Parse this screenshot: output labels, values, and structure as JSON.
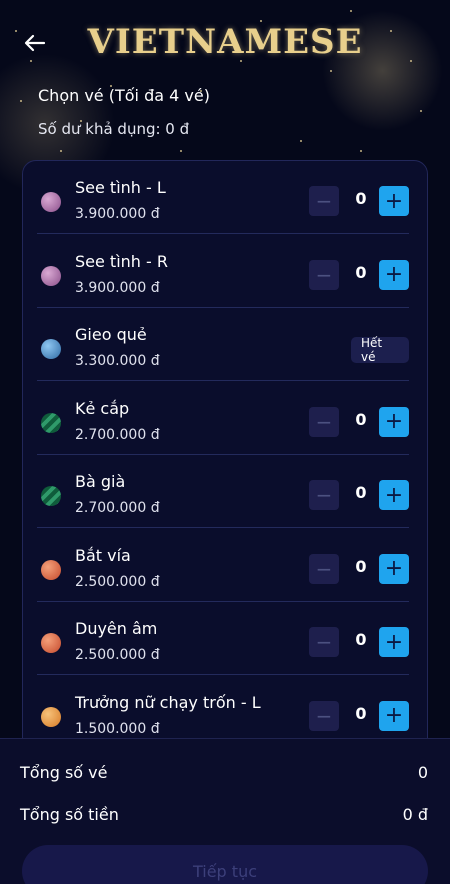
{
  "header": {
    "brand": "VIETNAMESE",
    "subtitle": "Chọn vé (Tối đa 4 vé)",
    "balance": "Số dư khả dụng: 0 đ"
  },
  "tickets": [
    {
      "name": "See tình - L",
      "price": "3.900.000 đ",
      "qty": "0",
      "color": "pink",
      "soldout": false
    },
    {
      "name": "See tình - R",
      "price": "3.900.000 đ",
      "qty": "0",
      "color": "pink",
      "soldout": false
    },
    {
      "name": "Gieo quẻ",
      "price": "3.300.000 đ",
      "qty": "",
      "color": "blue",
      "soldout": true,
      "soldout_label": "Hết vé"
    },
    {
      "name": "Kẻ cắp",
      "price": "2.700.000 đ",
      "qty": "0",
      "color": "green",
      "soldout": false
    },
    {
      "name": "Bà già",
      "price": "2.700.000 đ",
      "qty": "0",
      "color": "green",
      "soldout": false
    },
    {
      "name": "Bắt vía",
      "price": "2.500.000 đ",
      "qty": "0",
      "color": "orange",
      "soldout": false
    },
    {
      "name": "Duyên âm",
      "price": "2.500.000 đ",
      "qty": "0",
      "color": "orange",
      "soldout": false
    },
    {
      "name": "Trưởng nữ chạy trốn - L",
      "price": "1.500.000 đ",
      "qty": "0",
      "color": "amber",
      "soldout": false
    }
  ],
  "controls": {
    "minus": "−",
    "plus": "+"
  },
  "footer": {
    "total_tickets_label": "Tổng số vé",
    "total_tickets_value": "0",
    "total_amount_label": "Tổng số tiền",
    "total_amount_value": "0 đ",
    "continue_label": "Tiếp tục"
  }
}
